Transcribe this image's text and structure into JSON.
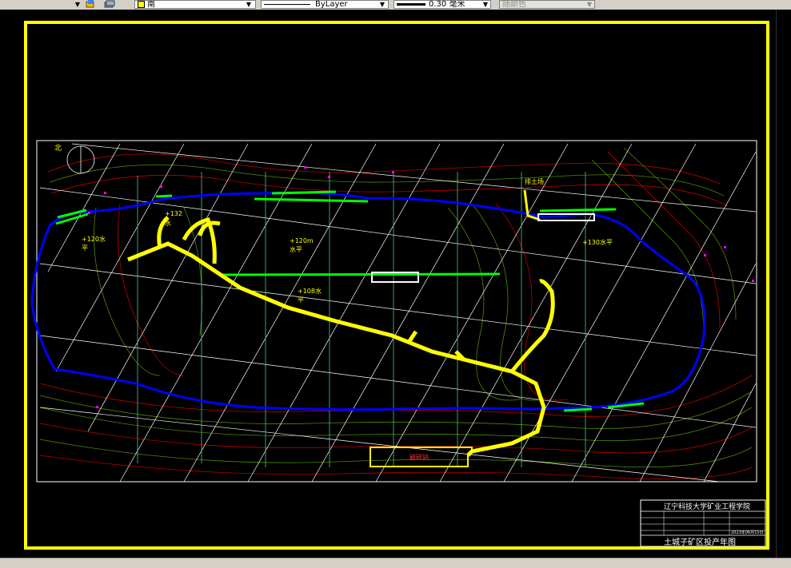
{
  "toolbar": {
    "layer_name": "南",
    "linetype": "ByLayer",
    "lineweight": "0.30 毫米",
    "plot_style": "随颜色"
  },
  "drawing": {
    "north_label": "北",
    "level_labels": {
      "l120": "+120水",
      "l120b": "平",
      "l132": "+132",
      "l132b": "水",
      "l120m": "+120m",
      "l120mb": "水平",
      "l108": "+108水",
      "l108b": "平",
      "l130": "+130水平",
      "dump": "排土场",
      "station": "破碎站"
    },
    "title_block": {
      "institution": "辽宁科技大学矿业工程学院",
      "drawing_title": "土城子矿区投产年图",
      "date": "2023年06月15日"
    }
  },
  "colors": {
    "frame": "#ffff00",
    "pit_boundary": "#0000ff",
    "haul_road": "#ffff00",
    "bench": "#00ff00",
    "contour_red": "#c00000",
    "contour_green": "#4f8a00",
    "grid": "#ffffff"
  }
}
